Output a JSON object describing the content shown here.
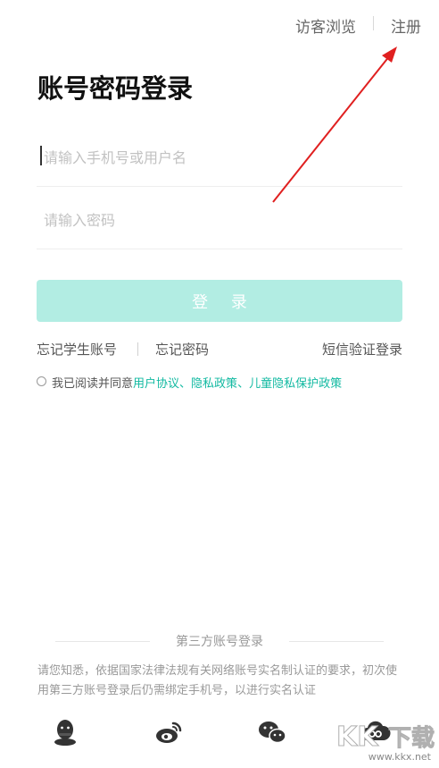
{
  "header": {
    "guest_label": "访客浏览",
    "register_label": "注册"
  },
  "page_title": "账号密码登录",
  "form": {
    "username": {
      "value": "",
      "placeholder": "请输入手机号或用户名"
    },
    "password": {
      "value": "",
      "placeholder": "请输入密码"
    },
    "login_label": "登 录"
  },
  "links": {
    "forgot_student": "忘记学生账号",
    "forgot_password": "忘记密码",
    "sms_login": "短信验证登录"
  },
  "agreement": {
    "prefix": "我已阅读并同意",
    "user_agreement": "用户协议",
    "sep1": "、",
    "privacy": "隐私政策",
    "sep2": "、",
    "child_privacy": "儿童隐私保护政策"
  },
  "third_party": {
    "title": "第三方账号登录",
    "notice": "请您知悉，依据国家法律法规有关网络账号实名制认证的要求，初次使用第三方账号登录后仍需绑定手机号，以进行实名认证",
    "icons": [
      "qq-icon",
      "weibo-icon",
      "wechat-icon",
      "cloud-icon"
    ]
  },
  "watermark": {
    "text": "www.kkx.net"
  },
  "colors": {
    "accent": "#11b9a1",
    "button_disabled": "#b2ede3",
    "annotation_arrow": "#e02020"
  }
}
